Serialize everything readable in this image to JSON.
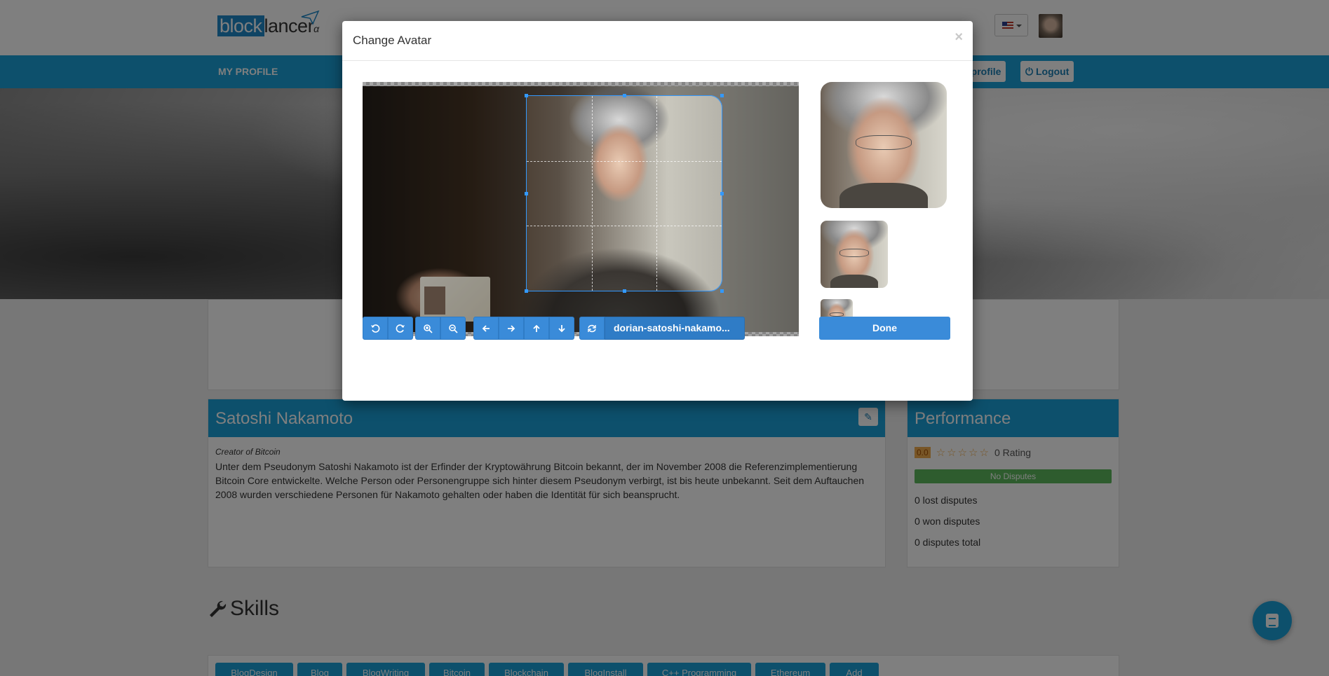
{
  "header": {
    "logo_block": "block",
    "logo_lancer": "lancer",
    "logo_alpha": "α"
  },
  "navbar": {
    "my_profile": "MY PROFILE",
    "public_profile": "c profile",
    "logout": "Logout"
  },
  "profile": {
    "name": "Satoshi Nakamoto",
    "tagline": "Creator of Bitcoin",
    "bio": "Unter dem Pseudonym Satoshi Nakamoto ist der Erfinder der Kryptowährung Bitcoin bekannt, der im November 2008 die Referenzimplementierung Bitcoin Core entwickelte. Welche Person oder Personengruppe sich hinter diesem Pseudonym verbirgt, ist bis heute unbekannt. Seit dem Auftauchen 2008 wurden verschiedene Personen für Nakamoto gehalten oder haben die Identität für sich beansprucht."
  },
  "performance": {
    "title": "Performance",
    "score": "0.0",
    "stars": "☆☆☆☆☆",
    "rating_label": "0 Rating",
    "disputes_badge": "No Disputes",
    "lost": "0 lost disputes",
    "won": "0 won disputes",
    "total": "0 disputes total"
  },
  "skills": {
    "title": "Skills",
    "tags": [
      "BlogDesign",
      "Blog",
      "BlogWriting",
      "Bitcoin",
      "Blockchain",
      "BlogInstall",
      "C++ Programming",
      "Ethereum",
      "Add"
    ]
  },
  "modal": {
    "title": "Change Avatar",
    "close": "×",
    "file_name": "dorian-satoshi-nakamo...",
    "done_label": "Done",
    "toolbar_icons": [
      "rotate-left-icon",
      "rotate-right-icon",
      "zoom-in-icon",
      "zoom-out-icon",
      "arrow-left-icon",
      "arrow-right-icon",
      "arrow-up-icon",
      "arrow-down-icon",
      "refresh-icon"
    ]
  },
  "colors": {
    "primary": "#1aa0d8",
    "button": "#3a8bd9",
    "success": "#5cb85c",
    "warning": "#f0ad4e",
    "crop_border": "#3399ff"
  }
}
